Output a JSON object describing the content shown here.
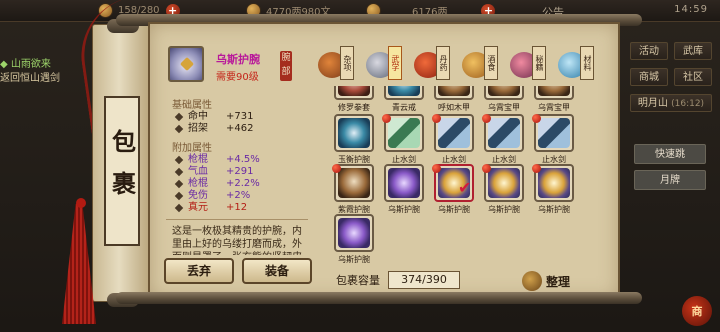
{
  "topbar": {
    "res1": "158/280",
    "res2": "4770两980文",
    "res3": "6176两",
    "notice": "公告",
    "time": "14:59"
  },
  "quest": {
    "line1": "◆ 山雨欲来",
    "line2": "返回恒山遇剑"
  },
  "right_menu": {
    "btn1": "活动",
    "btn2": "武库",
    "btn3": "商城",
    "btn4": "社区",
    "btn5": "明月山",
    "btn5_sub": "(16:12)",
    "list": [
      "快速跳",
      "月牌"
    ]
  },
  "panel": {
    "title": "包裹",
    "item": {
      "name": "乌斯护腕",
      "requirement": "需要90级",
      "slot": "腕部",
      "base_title": "基础属性",
      "base_stats": [
        {
          "k": "命中",
          "v": "+731"
        },
        {
          "k": "招架",
          "v": "+462"
        }
      ],
      "extra_title": "附加属性",
      "extra_stats": [
        {
          "k": "枪棍",
          "v": "+4.5%"
        },
        {
          "k": "气血",
          "v": "+291"
        },
        {
          "k": "枪棍",
          "v": "+2.2%"
        },
        {
          "k": "免伤",
          "v": "+2%"
        },
        {
          "k": "真元",
          "v": "+12"
        }
      ],
      "description": "这是一枚极其精贵的护腕，内里由上好的乌缕打磨而成，外面则是罩了一张玄熊的坚韧皮"
    },
    "discard": "丢弃",
    "equip": "装备",
    "tabs": [
      {
        "label": "杂项",
        "icon": "misc-icon"
      },
      {
        "label": "武学",
        "icon": "martial-icon"
      },
      {
        "label": "丹药",
        "icon": "pill-icon"
      },
      {
        "label": "酒食",
        "icon": "food-icon"
      },
      {
        "label": "秘籍",
        "icon": "book-icon"
      },
      {
        "label": "材料",
        "icon": "material-icon"
      }
    ],
    "grid_row0": [
      "修罗拳套",
      "青云戒",
      "呼如木甲",
      "乌霄宝甲",
      "乌霄宝甲"
    ],
    "grid_row1": [
      "玉衡护腕",
      "止水剑",
      "止水剑",
      "止水剑",
      "止水剑"
    ],
    "grid_row2": [
      "紫霞护腕",
      "乌斯护腕",
      "乌斯护腕",
      "乌斯护腕",
      "乌斯护腕"
    ],
    "grid_row3": [
      "乌斯护腕"
    ],
    "capacity_label": "包裹容量",
    "capacity_value": "374/390",
    "sort": "整理"
  },
  "corner_label": "商"
}
